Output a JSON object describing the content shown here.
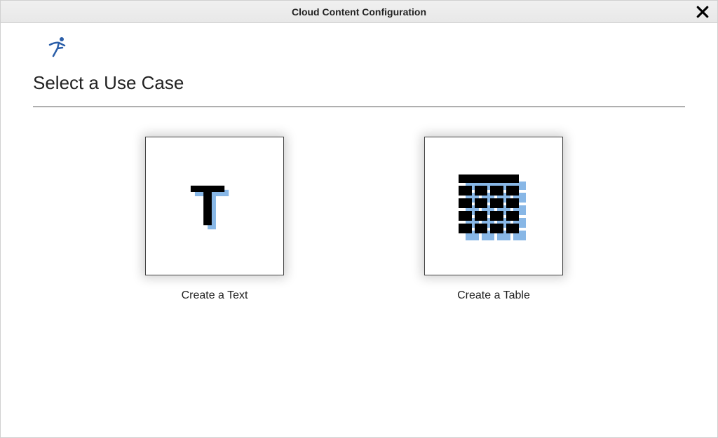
{
  "dialog": {
    "title": "Cloud Content Configuration"
  },
  "page": {
    "heading": "Select a Use Case"
  },
  "cards": {
    "text": {
      "label": "Create a Text"
    },
    "table": {
      "label": "Create a Table"
    }
  }
}
